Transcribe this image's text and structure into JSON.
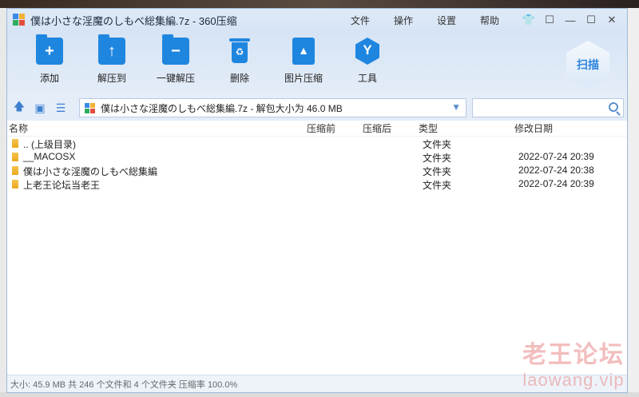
{
  "window": {
    "title": "僕は小さな淫魔のしもべ総集編.7z - 360压缩",
    "menu": [
      "文件",
      "操作",
      "设置",
      "帮助"
    ],
    "controls": {
      "shirt": "👕",
      "feedback": "☐",
      "minimize": "—",
      "maximize": "☐",
      "close": "✕"
    }
  },
  "toolbar": {
    "items": [
      {
        "label": "添加",
        "icon": "add-icon"
      },
      {
        "label": "解压到",
        "icon": "extract-to-icon"
      },
      {
        "label": "一键解压",
        "icon": "one-click-extract-icon"
      },
      {
        "label": "删除",
        "icon": "delete-icon"
      },
      {
        "label": "图片压缩",
        "icon": "image-compress-icon"
      },
      {
        "label": "工具",
        "icon": "tools-icon"
      }
    ],
    "scan_label": "扫描"
  },
  "address": {
    "path": "僕は小さな淫魔のしもべ総集編.7z - 解包大小为 46.0 MB",
    "search_placeholder": ""
  },
  "columns": {
    "name": "名称",
    "compressed": "压缩前",
    "size": "压缩后",
    "type": "类型",
    "date": "修改日期"
  },
  "rows": [
    {
      "name": ".. (上级目录)",
      "type": "文件夹",
      "date": ""
    },
    {
      "name": "__MACOSX",
      "type": "文件夹",
      "date": "2022-07-24 20:39"
    },
    {
      "name": "僕は小さな淫魔のしもべ総集編",
      "type": "文件夹",
      "date": "2022-07-24 20:38"
    },
    {
      "name": "上老王论坛当老王",
      "type": "文件夹",
      "date": "2022-07-24 20:39"
    }
  ],
  "status": "大小: 45.9 MB 共 246 个文件和 4 个文件夹 压缩率 100.0%",
  "watermark": {
    "cn": "老王论坛",
    "en": "laowang.vip"
  },
  "colors": {
    "accent": "#1f86e0",
    "titlebar": "#d6e4f5",
    "watermark": "#e88888"
  }
}
